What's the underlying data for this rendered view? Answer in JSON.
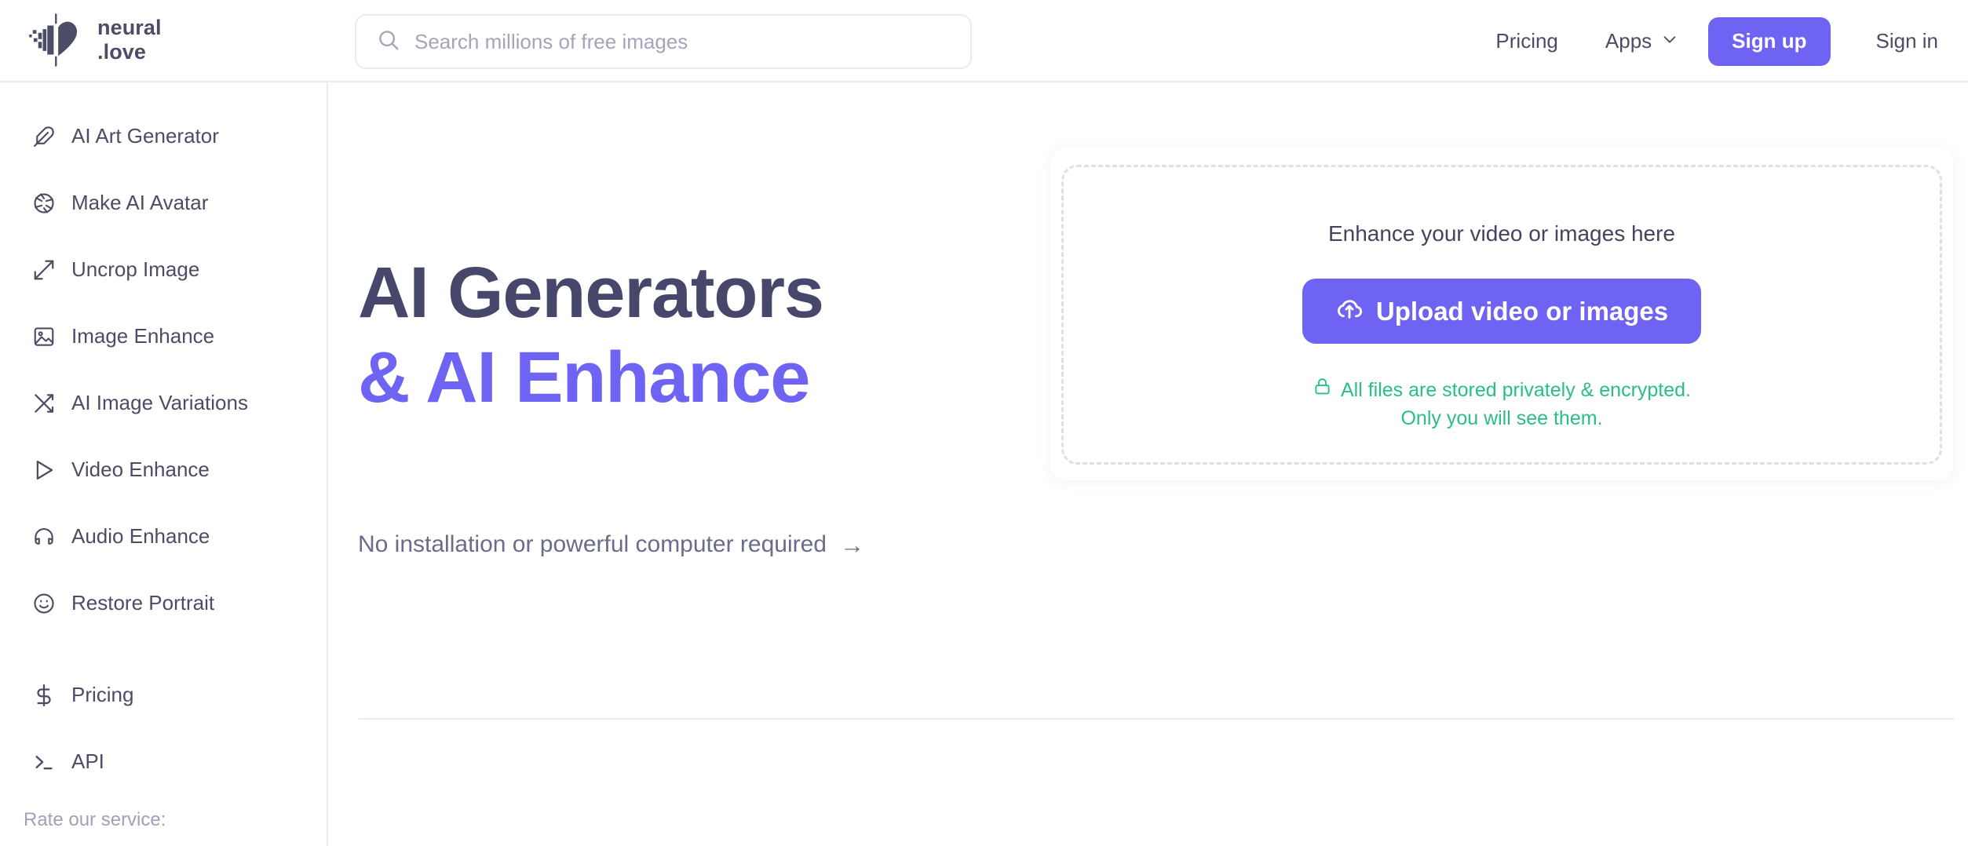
{
  "header": {
    "logo": {
      "icon": "pixel-heart-logo",
      "line1": "neural",
      "line2": ".love"
    },
    "search": {
      "icon": "search-icon",
      "value": "",
      "placeholder": "Search millions of free images"
    },
    "nav": {
      "pricing": "Pricing",
      "apps": "Apps",
      "apps_caret_icon": "chevron-down-icon",
      "signup": "Sign up",
      "signin": "Sign in"
    }
  },
  "sidebar": {
    "items": [
      {
        "label": "AI Art Generator",
        "icon": "feather-icon"
      },
      {
        "label": "Make AI Avatar",
        "icon": "aperture-icon"
      },
      {
        "label": "Uncrop Image",
        "icon": "expand-arrows-icon"
      },
      {
        "label": "Image Enhance",
        "icon": "image-icon"
      },
      {
        "label": "AI Image Variations",
        "icon": "shuffle-icon"
      },
      {
        "label": "Video Enhance",
        "icon": "play-icon"
      },
      {
        "label": "Audio Enhance",
        "icon": "headphones-icon"
      },
      {
        "label": "Restore Portrait",
        "icon": "smiley-icon"
      }
    ],
    "secondary": [
      {
        "label": "Pricing",
        "icon": "dollar-icon"
      },
      {
        "label": "API",
        "icon": "terminal-icon"
      }
    ],
    "rate_label": "Rate our service:"
  },
  "main": {
    "hero": {
      "title_line1": "AI Generators",
      "title_line2": "& AI Enhance",
      "subtitle": "No installation or powerful computer required",
      "subtitle_arrow": "→"
    },
    "upload": {
      "prompt": "Enhance your video or images here",
      "button_label": "Upload video or images",
      "button_icon": "cloud-upload-icon",
      "privacy_icon": "lock-icon",
      "privacy_line1": "All files are stored privately & encrypted.",
      "privacy_line2": "Only you will see them."
    }
  },
  "colors": {
    "accent_purple": "#6e63f2",
    "text_dark": "#4c4c66",
    "text_muted": "#a0a0b8",
    "green": "#29bd8b",
    "border": "#ebebf2"
  }
}
